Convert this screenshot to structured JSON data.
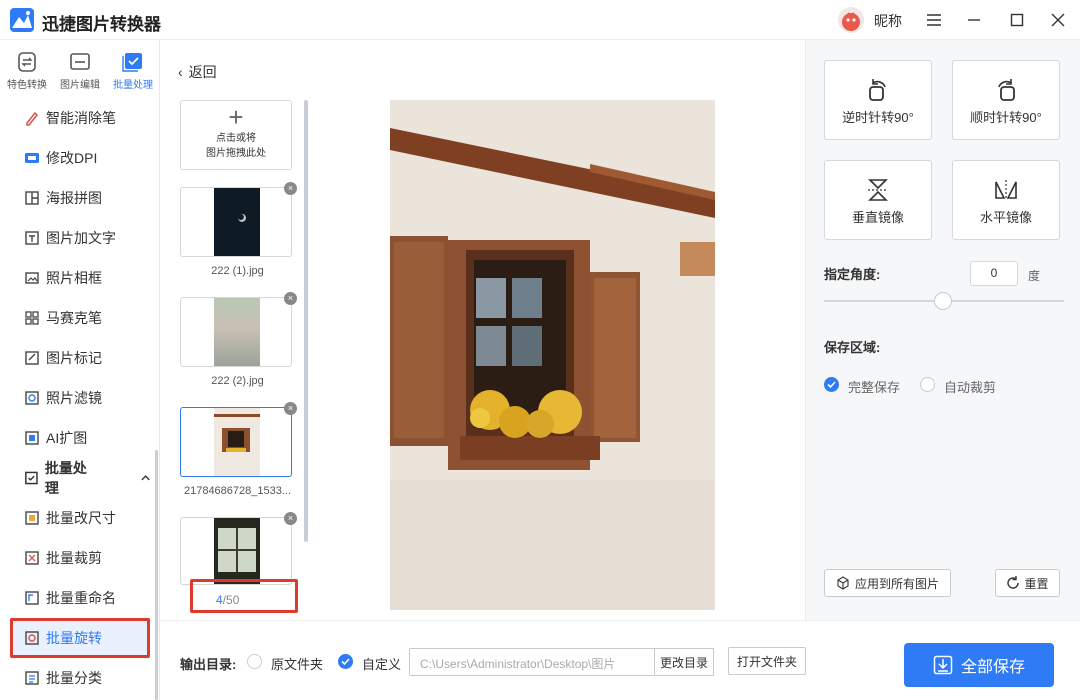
{
  "app": {
    "title": "迅捷图片转换器",
    "nickname": "昵称"
  },
  "tabs": [
    {
      "label": "特色转换",
      "icon": "swap-icon"
    },
    {
      "label": "图片编辑",
      "icon": "image-edit-icon"
    },
    {
      "label": "批量处理",
      "icon": "batch-check-icon"
    }
  ],
  "sidebar": {
    "items": [
      {
        "label": "智能消除笔",
        "icon": "eraser-pen-icon"
      },
      {
        "label": "修改DPI",
        "icon": "dpi-icon"
      },
      {
        "label": "海报拼图",
        "icon": "poster-collage-icon"
      },
      {
        "label": "图片加文字",
        "icon": "add-text-icon"
      },
      {
        "label": "照片相框",
        "icon": "photo-frame-icon"
      },
      {
        "label": "马赛克笔",
        "icon": "mosaic-icon"
      },
      {
        "label": "图片标记",
        "icon": "image-mark-icon"
      },
      {
        "label": "照片滤镜",
        "icon": "filter-icon"
      },
      {
        "label": "AI扩图",
        "icon": "ai-expand-icon"
      },
      {
        "label": "批量处理",
        "icon": "",
        "section": true
      },
      {
        "label": "批量改尺寸",
        "icon": "batch-resize-icon"
      },
      {
        "label": "批量裁剪",
        "icon": "batch-crop-icon"
      },
      {
        "label": "批量重命名",
        "icon": "batch-rename-icon"
      },
      {
        "label": "批量旋转",
        "icon": "batch-rotate-icon",
        "active": true
      },
      {
        "label": "批量分类",
        "icon": "batch-classify-icon"
      }
    ]
  },
  "middle": {
    "back_label": "返回",
    "add_line1": "点击或将",
    "add_line2": "图片拖拽此处",
    "thumbs": [
      {
        "name": "222 (1).jpg"
      },
      {
        "name": "222 (2).jpg"
      },
      {
        "name": "21784686728_1533..."
      },
      {
        "name": ""
      }
    ],
    "counter_current": "4",
    "counter_total": "/50"
  },
  "right": {
    "rotate_ccw": "逆时针转90°",
    "rotate_cw": "顺时针转90°",
    "flip_vertical": "垂直镜像",
    "flip_horizontal": "水平镜像",
    "angle_label": "指定角度:",
    "angle_value": "0",
    "angle_unit": "度",
    "angle_fraction": 0.5,
    "save_area_label": "保存区域:",
    "save_full": "完整保存",
    "auto_crop": "自动裁剪",
    "apply_all": "应用到所有图片",
    "reset": "重置"
  },
  "bottom": {
    "output_label": "输出目录:",
    "option_source": "原文件夹",
    "option_custom": "自定义",
    "path": "C:\\Users\\Administrator\\Desktop\\图片",
    "change_dir": "更改目录",
    "open_folder": "打开文件夹",
    "save_all": "全部保存"
  },
  "colors": {
    "accent": "#2f7bf5",
    "highlight": "#e0392d"
  }
}
